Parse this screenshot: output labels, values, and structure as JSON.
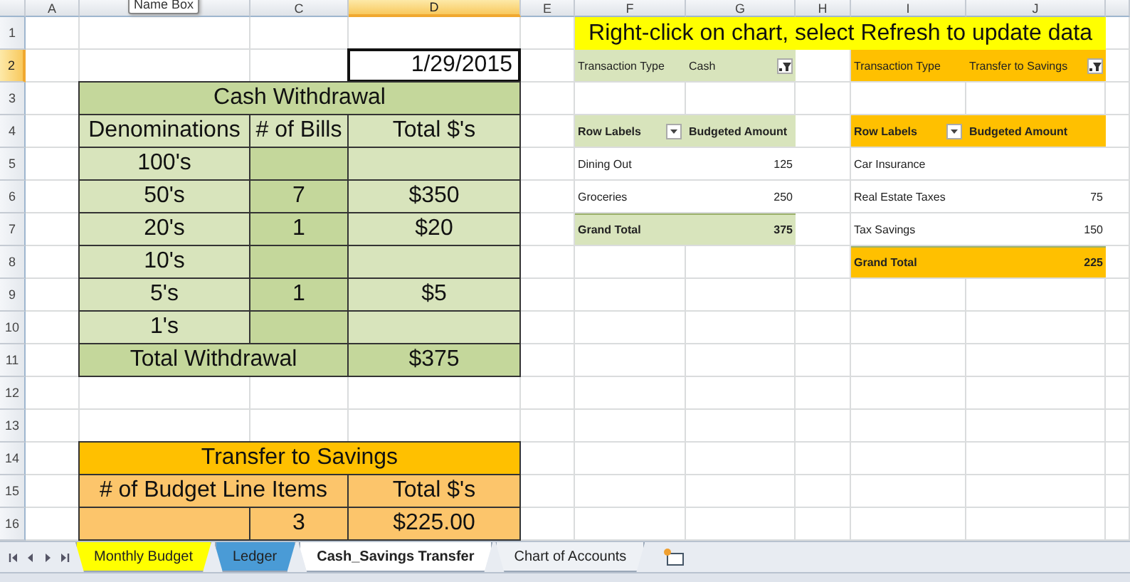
{
  "name_box_tooltip": "Name Box",
  "column_headers": [
    {
      "label": "A",
      "selected": false
    },
    {
      "selected": false
    },
    {
      "label": "C",
      "selected": false
    },
    {
      "label": "D",
      "selected": true
    },
    {
      "label": "E",
      "selected": false
    },
    {
      "label": "F",
      "selected": false
    },
    {
      "label": "G",
      "selected": false
    },
    {
      "label": "H",
      "selected": false
    },
    {
      "label": "I",
      "selected": false
    },
    {
      "label": "J",
      "selected": false
    }
  ],
  "row_headers": [
    {
      "label": "1",
      "selected": false
    },
    {
      "label": "2",
      "selected": true
    },
    {
      "label": "3",
      "selected": false
    },
    {
      "label": "4",
      "selected": false
    },
    {
      "label": "5",
      "selected": false
    },
    {
      "label": "6",
      "selected": false
    },
    {
      "label": "7",
      "selected": false
    },
    {
      "label": "8",
      "selected": false
    },
    {
      "label": "9",
      "selected": false
    },
    {
      "label": "10",
      "selected": false
    },
    {
      "label": "11",
      "selected": false
    },
    {
      "label": "12",
      "selected": false
    },
    {
      "label": "13",
      "selected": false
    },
    {
      "label": "14",
      "selected": false
    },
    {
      "label": "15",
      "selected": false
    },
    {
      "label": "16",
      "selected": false
    }
  ],
  "date_cell": "1/29/2015",
  "banner": "Right-click on chart, select Refresh to update data",
  "cash_withdrawal": {
    "title": "Cash Withdrawal",
    "columns": [
      "Denominations",
      "# of Bills",
      "Total $'s"
    ],
    "rows": [
      {
        "denomination": "100's"
      },
      {
        "denomination": "50's",
        "bills": "7",
        "total": "$350"
      },
      {
        "denomination": "20's",
        "bills": "1",
        "total": "$20"
      },
      {
        "denomination": "10's"
      },
      {
        "denomination": "5's",
        "bills": "1",
        "total": "$5"
      },
      {
        "denomination": "1's"
      }
    ],
    "total_label": "Total Withdrawal",
    "total_value": "$375"
  },
  "transfer_to_savings": {
    "title": "Transfer to Savings",
    "columns": [
      "# of Budget Line Items",
      "Total $'s"
    ],
    "count": "3",
    "total": "$225.00"
  },
  "pivots": [
    {
      "color": "#d8e4bc",
      "filter_label": "Transaction Type",
      "filter_value": "Cash",
      "columns": [
        "Row Labels",
        "Budgeted Amount"
      ],
      "rows": [
        {
          "label": "Dining Out",
          "amount": "125"
        },
        {
          "label": "Groceries",
          "amount": "250"
        }
      ],
      "grand_total_label": "Grand Total",
      "grand_total": "375"
    },
    {
      "color": "#ffc000",
      "filter_label": "Transaction Type",
      "filter_value": "Transfer to Savings",
      "columns": [
        "Row Labels",
        "Budgeted Amount"
      ],
      "rows": [
        {
          "label": "Car Insurance"
        },
        {
          "label": "Real Estate Taxes",
          "amount": "75"
        },
        {
          "label": "Tax Savings",
          "amount": "150"
        }
      ],
      "grand_total_label": "Grand Total",
      "grand_total": "225"
    }
  ],
  "sheet_tabs": [
    {
      "label": "Monthly Budget",
      "selected": false,
      "color": "#ffff00"
    },
    {
      "label": "Ledger",
      "selected": false,
      "color": "#4a9bd6"
    },
    {
      "label": "Cash_Savings Transfer",
      "selected": true
    },
    {
      "label": "Chart of Accounts",
      "selected": false
    }
  ]
}
